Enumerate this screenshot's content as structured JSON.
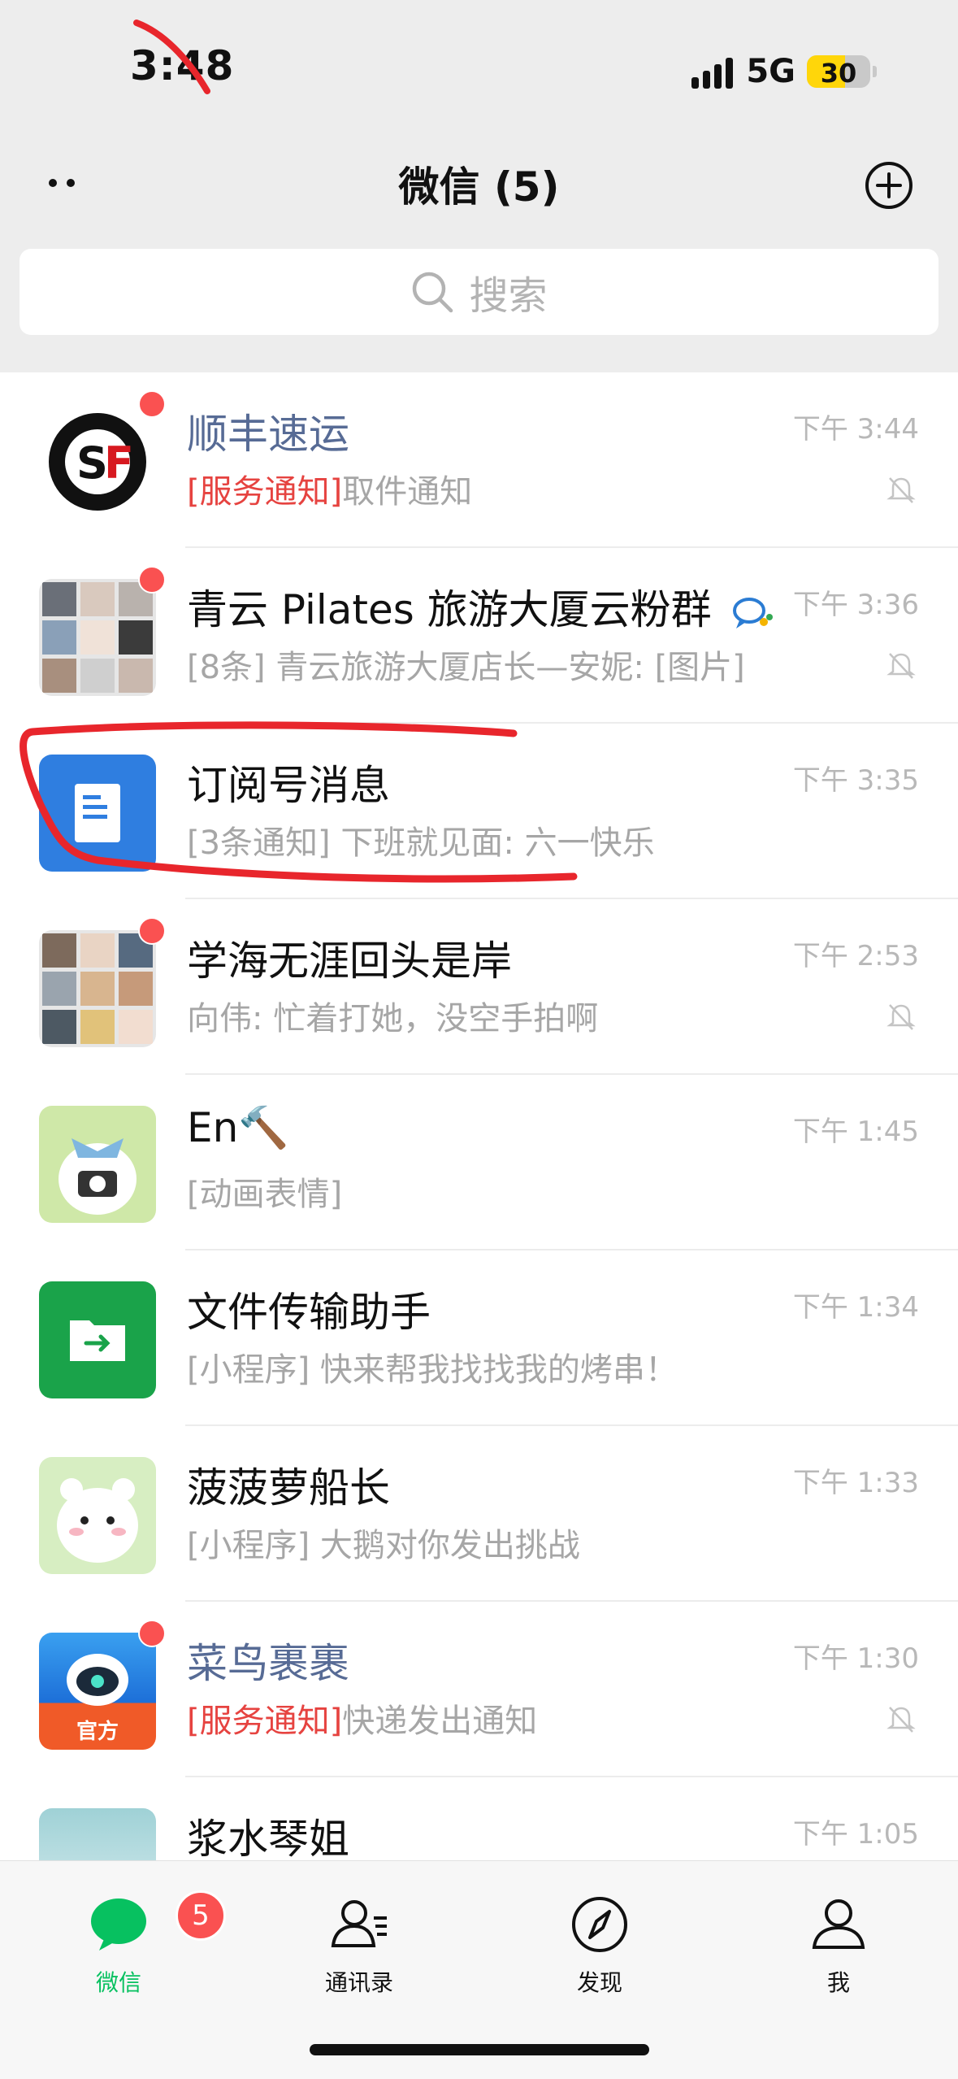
{
  "status_bar": {
    "time": "3:48",
    "network": "5G",
    "battery": "30",
    "battery_level": 0.3
  },
  "header": {
    "title": "微信 (5)"
  },
  "search": {
    "placeholder": "搜索"
  },
  "chats": [
    {
      "name": "顺丰速运",
      "tag": "[服务通知]",
      "preview": "取件通知",
      "time": "下午 3:44"
    },
    {
      "name": "青云 Pilates 旅游大厦云粉群",
      "tag": "",
      "preview": "[8条] 青云旅游大厦店长—安妮: [图片]",
      "time": "下午 3:36"
    },
    {
      "name": "订阅号消息",
      "tag": "",
      "preview": "[3条通知] 下班就见面: 六一快乐",
      "time": "下午 3:35"
    },
    {
      "name": "学海无涯回头是岸",
      "tag": "",
      "preview": "向伟: 忙着打她，没空手拍啊",
      "time": "下午 2:53"
    },
    {
      "name": "En🔨",
      "tag": "",
      "preview": "[动画表情]",
      "time": "下午 1:45"
    },
    {
      "name": "文件传输助手",
      "tag": "",
      "preview": "[小程序] 快来帮我找找我的烤串！",
      "time": "下午 1:34"
    },
    {
      "name": "菠菠萝船长",
      "tag": "",
      "preview": "[小程序] 大鹅对你发出挑战",
      "time": "下午 1:33"
    },
    {
      "name": "菜鸟裹裹",
      "tag": "[服务通知]",
      "preview": "快递发出通知",
      "time": "下午 1:30",
      "avatar_text": "官方"
    },
    {
      "name": "浆水琴姐",
      "tag": "",
      "preview": "",
      "time": "下午 1:05"
    }
  ],
  "tabbar": {
    "tabs": [
      {
        "label": "微信",
        "badge": "5"
      },
      {
        "label": "通讯录"
      },
      {
        "label": "发现"
      },
      {
        "label": "我"
      }
    ]
  },
  "colors": {
    "wechat_green": "#07c160",
    "badge_red": "#fa5151",
    "service_blue": "#576b95",
    "tag_red": "#e64340",
    "annotation_red": "#e8262c"
  }
}
